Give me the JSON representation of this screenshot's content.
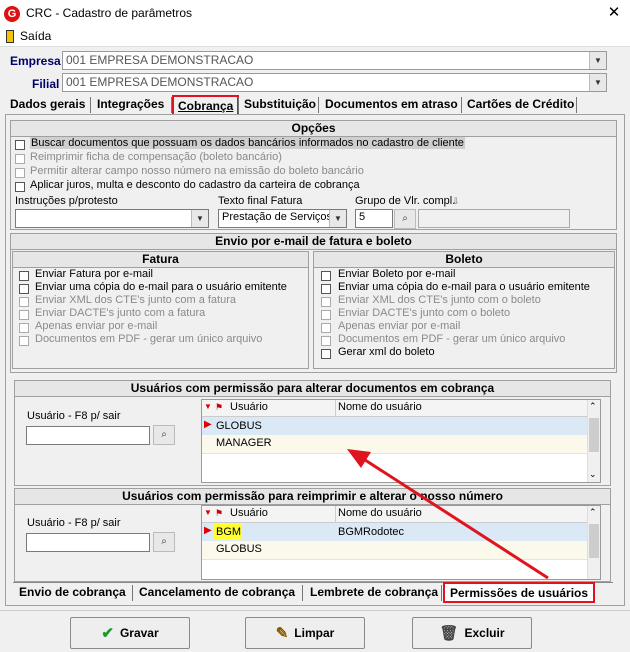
{
  "window": {
    "title": "CRC - Cadastro de parâmetros",
    "close_glyph": "✕",
    "app_icon": "crc-logo-icon",
    "app_icon_text": "G"
  },
  "menu": {
    "saida": "Saída"
  },
  "empresa": {
    "label": "Empresa",
    "value": "001 EMPRESA DEMONSTRACAO"
  },
  "filial": {
    "label": "Filial",
    "value": "001 EMPRESA DEMONSTRACAO"
  },
  "tabs": [
    "Dados gerais",
    "Integrações",
    "Cobrança",
    "Substituição",
    "Documentos em atraso",
    "Cartões de Crédito"
  ],
  "active_tab": "Cobrança",
  "opcoes": {
    "title": "Opções",
    "items": [
      {
        "label": "Buscar documentos que possuam os dados bancários informados no cadastro de cliente",
        "enabled": true,
        "highlight": true
      },
      {
        "label": "Reimprimir ficha de compensação (boleto bancário)",
        "enabled": false
      },
      {
        "label": "Permitir alterar campo nosso número na emissão do boleto bancário",
        "enabled": false
      },
      {
        "label": "Aplicar juros, multa e desconto do cadastro da carteira de cobrança",
        "enabled": true
      }
    ],
    "instrucoes_label": "Instruções p/protesto",
    "instrucoes_value": "",
    "texto_final_label": "Texto final Fatura",
    "texto_final_value": "Prestação de Serviços",
    "grupo_label": "Grupo de Vlr. compl.",
    "grupo_value": "5"
  },
  "envio": {
    "title": "Envio por e-mail de fatura e boleto",
    "fatura": {
      "title": "Fatura",
      "items": [
        {
          "label": "Enviar Fatura por e-mail",
          "enabled": true
        },
        {
          "label": "Enviar uma cópia do e-mail para o usuário emitente",
          "enabled": true
        },
        {
          "label": "Enviar XML dos CTE's  junto com a fatura",
          "enabled": false
        },
        {
          "label": "Enviar DACTE's junto com a fatura",
          "enabled": false
        },
        {
          "label": "Apenas enviar por e-mail",
          "enabled": false
        },
        {
          "label": "Documentos em PDF - gerar um único arquivo",
          "enabled": false
        }
      ]
    },
    "boleto": {
      "title": "Boleto",
      "items": [
        {
          "label": "Enviar Boleto por e-mail",
          "enabled": true
        },
        {
          "label": "Enviar uma cópia do e-mail para o usuário emitente",
          "enabled": true
        },
        {
          "label": "Enviar XML dos CTE's  junto com o boleto",
          "enabled": false
        },
        {
          "label": "Enviar DACTE's junto com o boleto",
          "enabled": false
        },
        {
          "label": "Apenas enviar por e-mail",
          "enabled": false
        },
        {
          "label": "Documentos em PDF - gerar um único arquivo",
          "enabled": false
        },
        {
          "label": "Gerar xml do boleto",
          "enabled": true
        }
      ]
    }
  },
  "perm_alterar": {
    "title": "Usuários com permissão para alterar documentos em cobrança",
    "usuario_label": "Usuário - F8 p/ sair",
    "columns": [
      "Usuário",
      "Nome do usuário"
    ],
    "rows": [
      {
        "usuario": "GLOBUS",
        "nome": "",
        "selected": true
      },
      {
        "usuario": "MANAGER",
        "nome": "",
        "selected": false
      }
    ]
  },
  "perm_reimprimir": {
    "title": "Usuários com permissão para reimprimir e alterar o nosso número",
    "usuario_label": "Usuário - F8 p/ sair",
    "columns": [
      "Usuário",
      "Nome do usuário"
    ],
    "rows": [
      {
        "usuario": "BGM",
        "nome": "BGMRodotec",
        "selected": true
      },
      {
        "usuario": "GLOBUS",
        "nome": "",
        "selected": false
      }
    ]
  },
  "bottom_tabs": [
    "Envio de cobrança",
    "Cancelamento de cobrança",
    "Lembrete de cobrança",
    "Permissões de usuários"
  ],
  "active_bottom_tab": "Permissões de usuários",
  "buttons": {
    "gravar": "Gravar",
    "limpar": "Limpar",
    "excluir": "Excluir"
  },
  "colors": {
    "annotation": "#e0141e",
    "header_blue": "#00006a",
    "selected_row": "#dbe9f6",
    "highlight_yellow": "#ffff33"
  }
}
